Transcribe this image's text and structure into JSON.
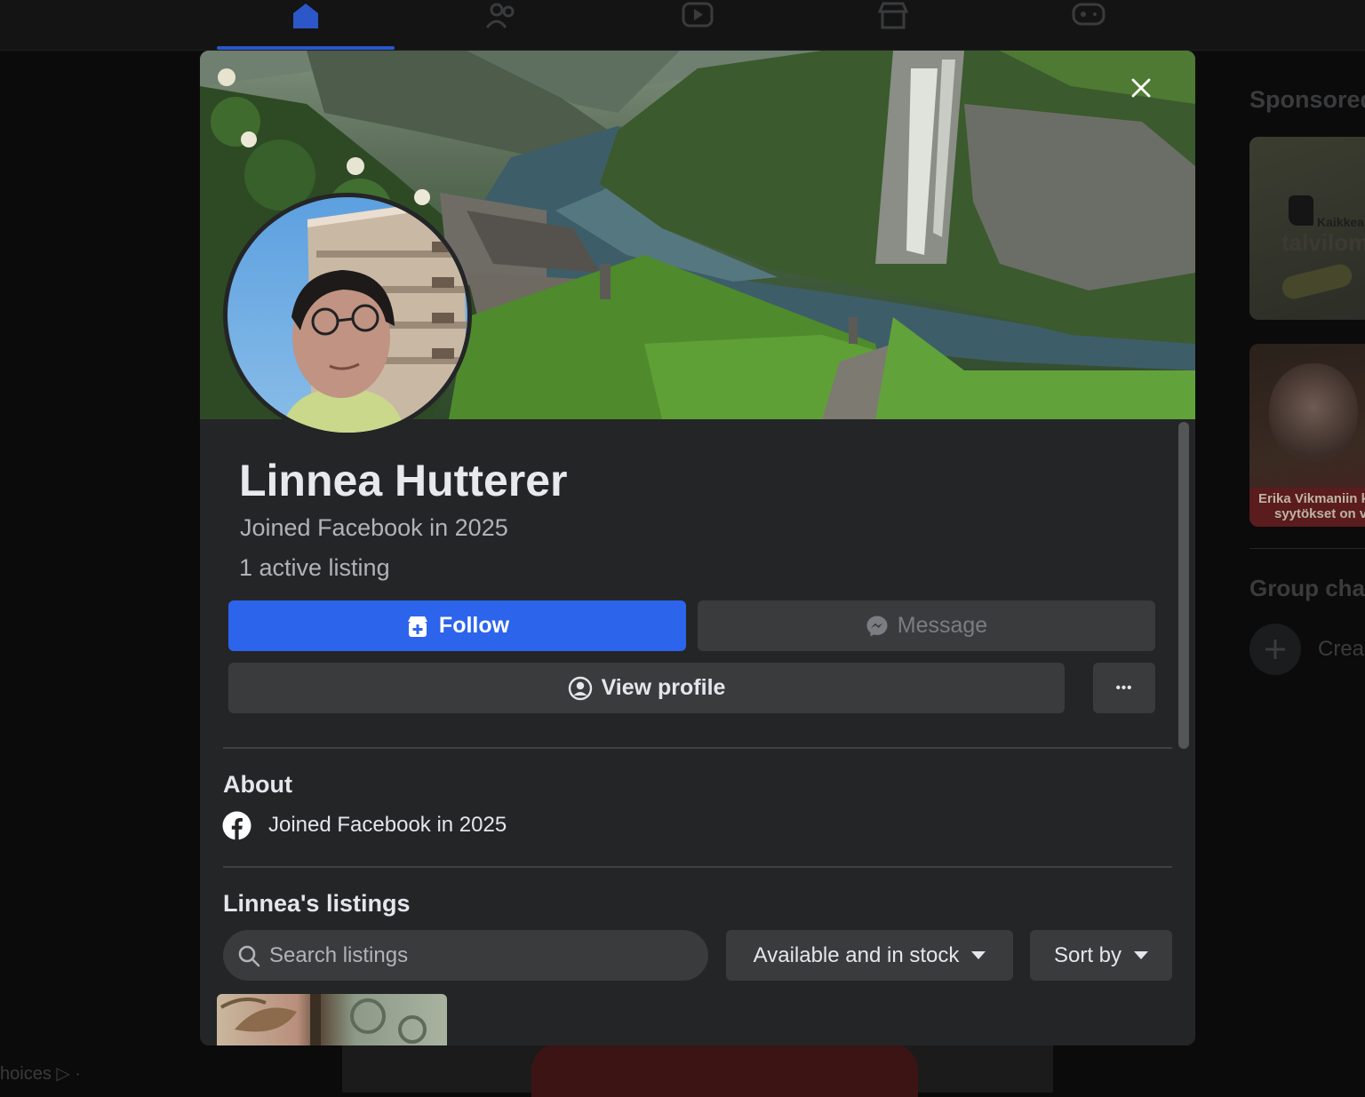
{
  "nav": {
    "icons": [
      "home-icon",
      "friends-icon",
      "video-icon",
      "marketplace-icon",
      "gaming-icon"
    ],
    "active_color": "#2c57c9"
  },
  "right_column": {
    "sponsored_title": "Sponsored",
    "ads": [
      {
        "text_small": "Kaikkea",
        "text_large": "talvilome"
      },
      {
        "caption_line1": "Erika Vikmaniin ko",
        "caption_line2": "syytökset on val"
      }
    ],
    "group_chats_title": "Group cha",
    "create_label": "Crea"
  },
  "footer": {
    "adchoices": "hoices ▷ ·"
  },
  "modal": {
    "profile": {
      "name": "Linnea Hutterer",
      "joined": "Joined Facebook in 2025",
      "active_listings": "1 active listing"
    },
    "actions": {
      "follow_label": "Follow",
      "message_label": "Message",
      "view_profile_label": "View profile",
      "more_label": "•••"
    },
    "about": {
      "title": "About",
      "joined": "Joined Facebook in 2025"
    },
    "listings": {
      "title": "Linnea's listings",
      "search_placeholder": "Search listings",
      "filter_label": "Available and in stock",
      "sort_label": "Sort by"
    },
    "colors": {
      "follow_button": "#2d64ec",
      "surface": "#242526",
      "secondary_button": "#3a3b3c"
    }
  }
}
